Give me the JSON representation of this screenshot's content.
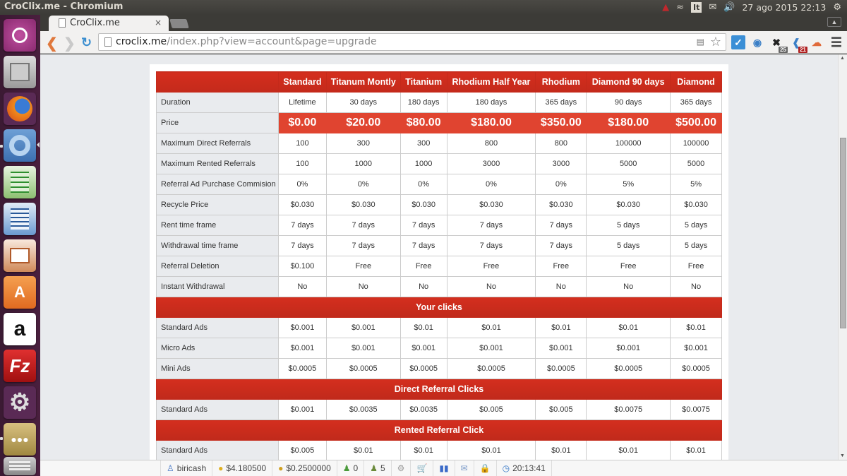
{
  "window": {
    "title": "CroClix.me - Chromium"
  },
  "tray": {
    "language": "It",
    "datetime": "27 ago 2015 22:13"
  },
  "browser": {
    "tab_title": "CroClix.me",
    "tab_close": "×",
    "url_host": "croclix.me",
    "url_path": "/index.php?view=account&page=upgrade",
    "extension_badges": [
      "25",
      "21"
    ]
  },
  "launcher": {
    "apps": [
      "Ubuntu Dash",
      "Files",
      "Firefox",
      "Chromium",
      "LibreOffice Calc",
      "LibreOffice Writer",
      "LibreOffice Impress",
      "Ubuntu Software Center",
      "Amazon",
      "FileZilla",
      "System Settings",
      "Workspaces",
      "Trash"
    ]
  },
  "table": {
    "headers": [
      "",
      "Standard",
      "Titanum Montly",
      "Titanium",
      "Rhodium Half Year",
      "Rhodium",
      "Diamond 90 days",
      "Diamond"
    ],
    "rows": [
      {
        "label": "Duration",
        "values": [
          "Lifetime",
          "30 days",
          "180 days",
          "180 days",
          "365 days",
          "90 days",
          "365 days"
        ]
      },
      {
        "label": "Price",
        "values": [
          "$0.00",
          "$20.00",
          "$80.00",
          "$180.00",
          "$350.00",
          "$180.00",
          "$500.00"
        ]
      },
      {
        "label": "Maximum Direct Referrals",
        "values": [
          "100",
          "300",
          "300",
          "800",
          "800",
          "100000",
          "100000"
        ]
      },
      {
        "label": "Maximum Rented Referrals",
        "values": [
          "100",
          "1000",
          "1000",
          "3000",
          "3000",
          "5000",
          "5000"
        ]
      },
      {
        "label": "Referral Ad Purchase Commision",
        "values": [
          "0%",
          "0%",
          "0%",
          "0%",
          "0%",
          "5%",
          "5%"
        ]
      },
      {
        "label": "Recycle Price",
        "values": [
          "$0.030",
          "$0.030",
          "$0.030",
          "$0.030",
          "$0.030",
          "$0.030",
          "$0.030"
        ]
      },
      {
        "label": "Rent time frame",
        "values": [
          "7 days",
          "7 days",
          "7 days",
          "7 days",
          "7 days",
          "5 days",
          "5 days"
        ]
      },
      {
        "label": "Withdrawal time frame",
        "values": [
          "7 days",
          "7 days",
          "7 days",
          "7 days",
          "7 days",
          "5 days",
          "5 days"
        ]
      },
      {
        "label": "Referral Deletion",
        "values": [
          "$0.100",
          "Free",
          "Free",
          "Free",
          "Free",
          "Free",
          "Free"
        ]
      },
      {
        "label": "Instant Withdrawal",
        "values": [
          "No",
          "No",
          "No",
          "No",
          "No",
          "No",
          "No"
        ]
      }
    ],
    "sections": [
      {
        "title": "Your clicks",
        "rows": [
          {
            "label": "Standard Ads",
            "values": [
              "$0.001",
              "$0.001",
              "$0.01",
              "$0.01",
              "$0.01",
              "$0.01",
              "$0.01"
            ]
          },
          {
            "label": "Micro Ads",
            "values": [
              "$0.001",
              "$0.001",
              "$0.001",
              "$0.001",
              "$0.001",
              "$0.001",
              "$0.001"
            ]
          },
          {
            "label": "Mini Ads",
            "values": [
              "$0.0005",
              "$0.0005",
              "$0.0005",
              "$0.0005",
              "$0.0005",
              "$0.0005",
              "$0.0005"
            ]
          }
        ]
      },
      {
        "title": "Direct Referral Clicks",
        "rows": [
          {
            "label": "Standard Ads",
            "values": [
              "$0.001",
              "$0.0035",
              "$0.0035",
              "$0.005",
              "$0.005",
              "$0.0075",
              "$0.0075"
            ]
          }
        ]
      },
      {
        "title": "Rented Referral Click",
        "rows": [
          {
            "label": "Standard Ads",
            "values": [
              "$0.005",
              "$0.01",
              "$0.01",
              "$0.01",
              "$0.01",
              "$0.01",
              "$0.01"
            ]
          }
        ]
      }
    ]
  },
  "statusbar": {
    "username": "biricash",
    "main_balance": "$4.180500",
    "purchase_balance": "$0.2500000",
    "direct_referrals": "0",
    "rented_referrals": "5",
    "clock": "20:13:41"
  },
  "colors": {
    "accent_red": "#c42a1b",
    "price_red": "#e04430",
    "label_bg": "#e9ebee"
  }
}
